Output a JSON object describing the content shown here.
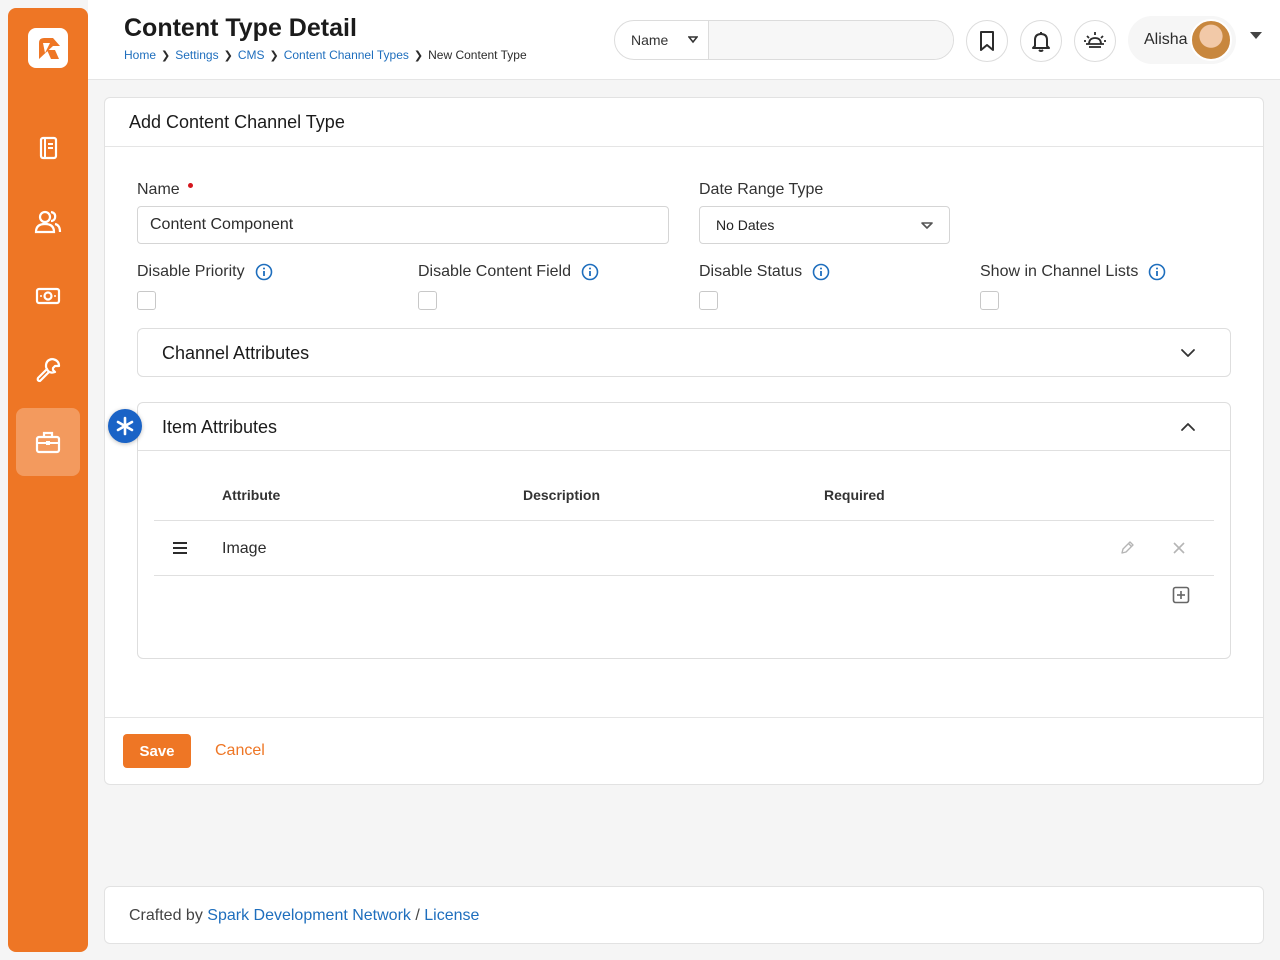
{
  "colors": {
    "brand": "#ee7625",
    "link": "#1e6ebd",
    "required": "#d4161d",
    "badge": "#1a63c6"
  },
  "header": {
    "title": "Content Type Detail",
    "breadcrumb": [
      "Home",
      "Settings",
      "CMS",
      "Content Channel Types",
      "New Content Type"
    ],
    "search": {
      "type": "Name",
      "value": ""
    },
    "user": {
      "name": "Alisha"
    }
  },
  "sidebar": {
    "items": [
      {
        "icon": "notebook-icon"
      },
      {
        "icon": "people-icon"
      },
      {
        "icon": "money-icon"
      },
      {
        "icon": "wrench-icon"
      },
      {
        "icon": "briefcase-icon",
        "active": true
      }
    ]
  },
  "form": {
    "title": "Add Content Channel Type",
    "name_label": "Name",
    "name_value": "Content Component",
    "date_range_label": "Date Range Type",
    "date_range_value": "No Dates",
    "checkboxes": [
      {
        "label": "Disable Priority",
        "checked": false
      },
      {
        "label": "Disable Content Field",
        "checked": false
      },
      {
        "label": "Disable Status",
        "checked": false
      },
      {
        "label": "Show in Channel Lists",
        "checked": false
      }
    ],
    "channel_attributes": {
      "title": "Channel Attributes",
      "expanded": false
    },
    "item_attributes": {
      "title": "Item Attributes",
      "expanded": true,
      "columns": [
        "Attribute",
        "Description",
        "Required"
      ],
      "rows": [
        {
          "attribute": "Image",
          "description": "",
          "required": ""
        }
      ]
    },
    "save_label": "Save",
    "cancel_label": "Cancel"
  },
  "footer": {
    "prefix": "Crafted by",
    "org": "Spark Development Network",
    "sep": "/",
    "license": "License"
  }
}
